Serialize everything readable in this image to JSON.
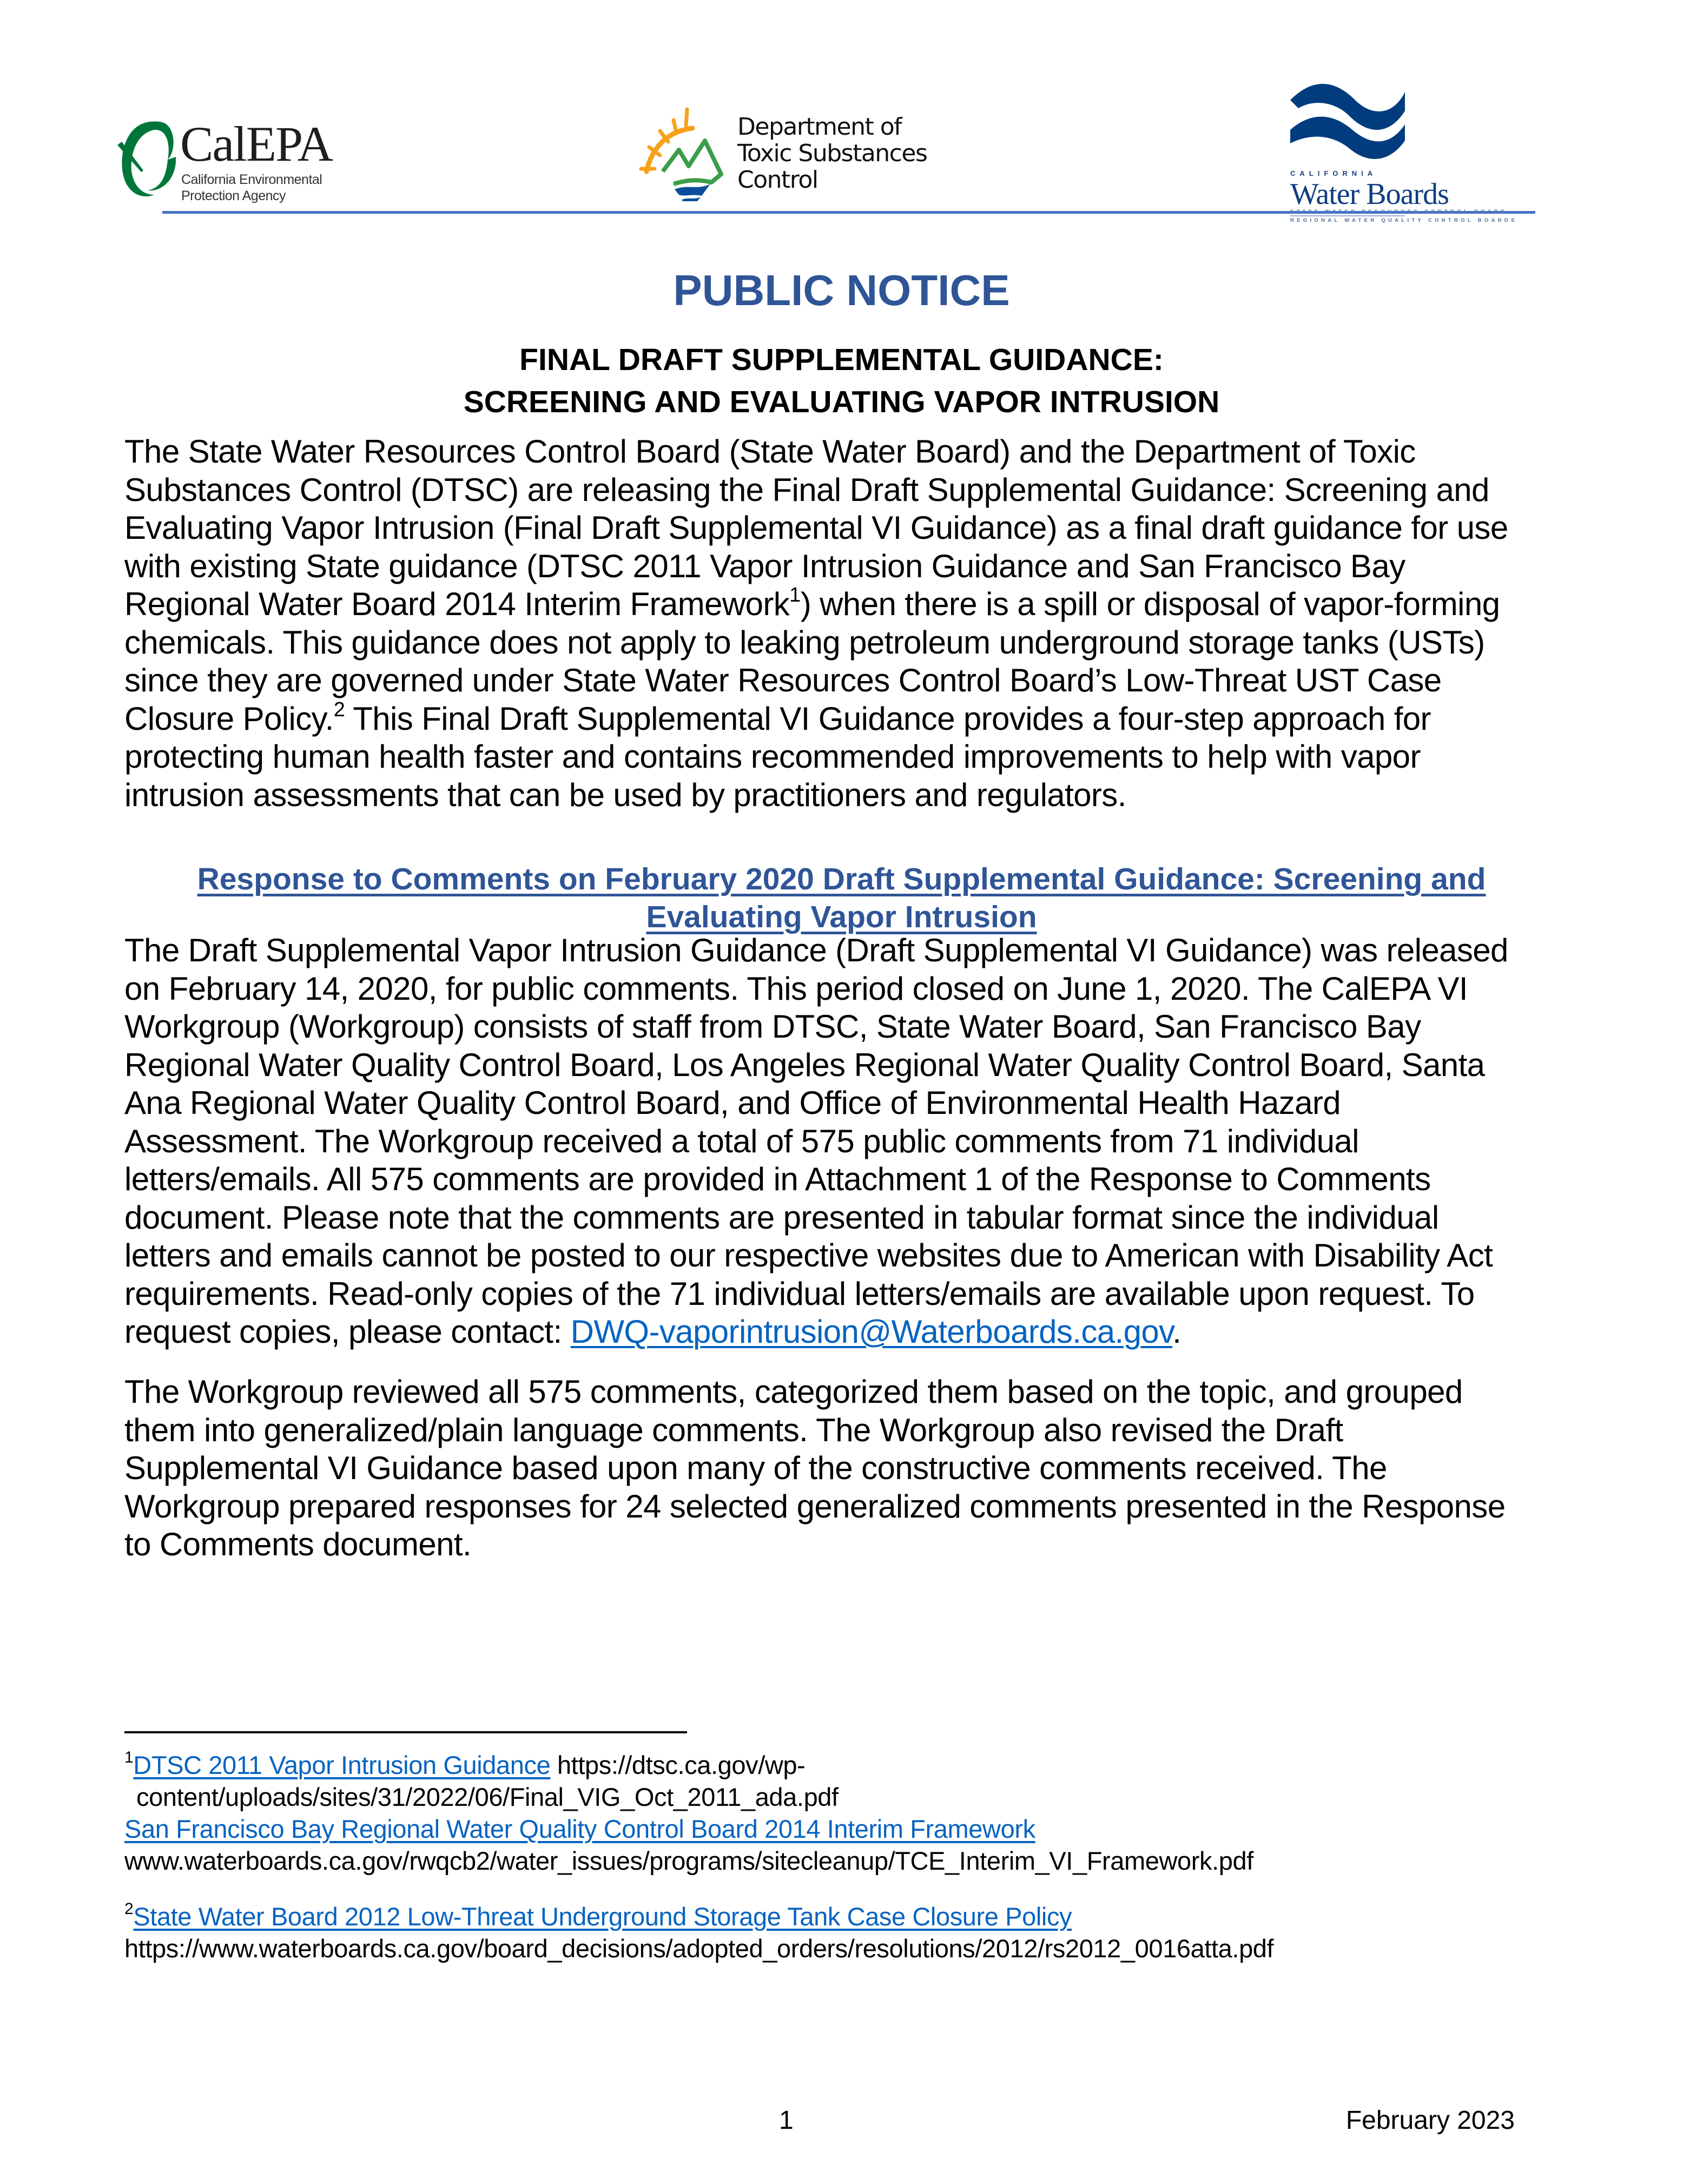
{
  "header": {
    "logos": {
      "calepa": {
        "name": "CalEPA",
        "subtitle_line1": "California Environmental",
        "subtitle_line2": "Protection Agency"
      },
      "dtsc": {
        "line1": "Department of",
        "line2": "Toxic Substances",
        "line3": "Control"
      },
      "water_boards": {
        "state": "CALIFORNIA",
        "name": "Water Boards",
        "sub1": "STATE WATER RESOURCES CONTROL BOARD",
        "sub2": "REGIONAL WATER QUALITY CONTROL BOARDS"
      }
    },
    "colors": {
      "rule": "#4472c4",
      "title": "#2f5597",
      "link": "#0563c1",
      "calepa_green": "#00763a",
      "dtsc_orange": "#f7a11a",
      "dtsc_green": "#3a9e47",
      "dtsc_blue": "#0b4f9c",
      "water_boards_blue": "#003c7e"
    }
  },
  "title": "PUBLIC NOTICE",
  "subtitle": {
    "line1": "FINAL DRAFT SUPPLEMENTAL GUIDANCE:",
    "line2": "SCREENING AND EVALUATING VAPOR INTRUSION"
  },
  "paragraph1": {
    "lines": [
      "The State Water Resources Control Board (State Water Board) and the Department of Toxic",
      "Substances Control (DTSC) are releasing the Final Draft Supplemental Guidance: Screening and",
      "Evaluating Vapor Intrusion (Final Draft Supplemental VI Guidance) as a final draft guidance for use",
      "with existing State guidance (DTSC 2011 Vapor Intrusion Guidance and San Francisco Bay"
    ],
    "line5_before": "Regional Water Board 2014 Interim Framework",
    "line5_sup": "1",
    "line5_after": ") when there is a spill or disposal of vapor-forming",
    "line6": "chemicals.  This guidance does not apply to leaking petroleum underground storage tanks (USTs)",
    "line7": "since they are governed under State Water Resources Control Board’s Low-Threat UST Case",
    "line8_before": "Closure Policy.",
    "line8_sup": "2",
    "line8_after": " This Final Draft Supplemental VI Guidance provides a four-step approach for",
    "line9": "protecting human health faster and contains recommended improvements to help with vapor",
    "line10": "intrusion assessments that can be used by practitioners and regulators."
  },
  "response_heading": {
    "line1": "Response to Comments on February 2020 Draft Supplemental Guidance: Screening and",
    "line2": "Evaluating Vapor Intrusion"
  },
  "paragraph2": {
    "lines": [
      "The Draft Supplemental Vapor Intrusion Guidance (Draft Supplemental VI Guidance) was released",
      "on February 14, 2020, for public comments. This period closed on June 1, 2020. The CalEPA VI",
      "Workgroup (Workgroup) consists of staff from DTSC, State Water Board, San Francisco Bay",
      "Regional Water Quality Control Board, Los Angeles Regional Water Quality Control Board, Santa",
      "Ana Regional Water Quality Control Board, and Office of Environmental Health Hazard",
      "Assessment. The Workgroup received a total of 575 public comments from 71 individual",
      "letters/emails.  All 575 comments are provided in Attachment 1 of the Response to Comments",
      "document. Please note that the comments are presented in tabular format since the individual",
      "letters and emails cannot be posted to our respective websites due to American with Disability Act",
      "requirements. Read-only copies of the 71 individual letters/emails are available upon request. To"
    ],
    "last_line_before": "request copies, please contact: ",
    "contact_email": "DWQ-vaporintrusion@Waterboards.ca.gov",
    "last_line_after": "."
  },
  "paragraph3": {
    "lines": [
      "The Workgroup reviewed all 575 comments, categorized them based on the topic, and grouped",
      "them into generalized/plain language comments. The Workgroup also revised the Draft",
      "Supplemental VI Guidance based upon many of the constructive comments received.  The",
      "Workgroup prepared responses for 24 selected generalized comments presented in the Response",
      "to Comments document."
    ]
  },
  "footnotes": [
    {
      "number": "1",
      "link1_text": "DTSC 2011 Vapor Intrusion Guidance",
      "url1_part1": " https://dtsc.ca.gov/wp-",
      "url1_part2": "content/uploads/sites/31/2022/06/Final_VIG_Oct_2011_ada.pdf",
      "link2_text": "San Francisco Bay Regional Water Quality Control Board 2014 Interim Framework",
      "url2": "www.waterboards.ca.gov/rwqcb2/water_issues/programs/sitecleanup/TCE_Interim_VI_Framework.pdf"
    },
    {
      "number": "2",
      "link_text": "State Water Board 2012 Low-Threat Underground Storage Tank Case Closure Policy",
      "url": "https://www.waterboards.ca.gov/board_decisions/adopted_orders/resolutions/2012/rs2012_0016atta.pdf"
    }
  ],
  "footer": {
    "page_number": "1",
    "date": "February 2023"
  }
}
